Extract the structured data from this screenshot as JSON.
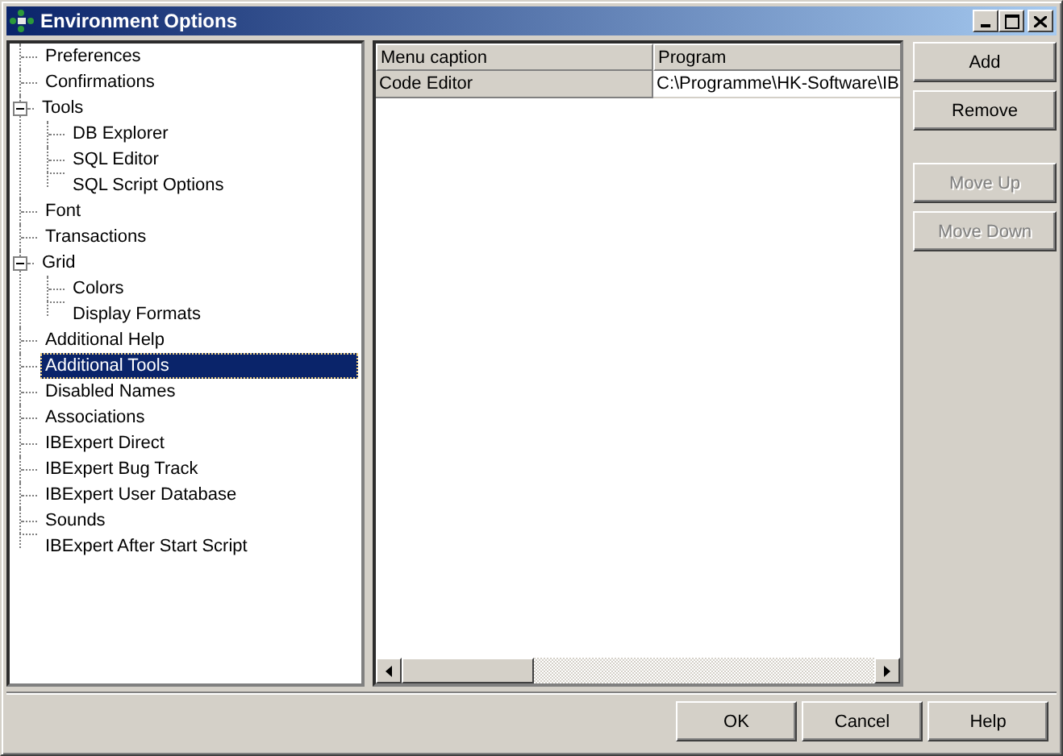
{
  "window": {
    "title": "Environment Options"
  },
  "tree": [
    {
      "label": "Preferences",
      "selected": false
    },
    {
      "label": "Confirmations",
      "selected": false
    },
    {
      "label": "Tools",
      "selected": false,
      "expanded": true,
      "children": [
        {
          "label": "DB Explorer",
          "selected": false
        },
        {
          "label": "SQL Editor",
          "selected": false
        },
        {
          "label": "SQL Script Options",
          "selected": false
        }
      ]
    },
    {
      "label": "Font",
      "selected": false
    },
    {
      "label": "Transactions",
      "selected": false
    },
    {
      "label": "Grid",
      "selected": false,
      "expanded": true,
      "children": [
        {
          "label": "Colors",
          "selected": false
        },
        {
          "label": "Display Formats",
          "selected": false
        }
      ]
    },
    {
      "label": "Additional Help",
      "selected": false
    },
    {
      "label": "Additional Tools",
      "selected": true
    },
    {
      "label": "Disabled Names",
      "selected": false
    },
    {
      "label": "Associations",
      "selected": false
    },
    {
      "label": "IBExpert Direct",
      "selected": false
    },
    {
      "label": "IBExpert Bug Track",
      "selected": false
    },
    {
      "label": "IBExpert User Database",
      "selected": false
    },
    {
      "label": "Sounds",
      "selected": false
    },
    {
      "label": "IBExpert After Start Script",
      "selected": false
    }
  ],
  "grid": {
    "columns": [
      "Menu caption",
      "Program"
    ],
    "rows": [
      [
        "Code Editor",
        "C:\\Programme\\HK-Software\\IB"
      ]
    ]
  },
  "side_buttons": [
    {
      "label": "Add",
      "disabled": false
    },
    {
      "label": "Remove",
      "disabled": false
    },
    {
      "label": "Move Up",
      "disabled": true
    },
    {
      "label": "Move Down",
      "disabled": true
    }
  ],
  "footer_buttons": [
    "OK",
    "Cancel",
    "Help"
  ]
}
